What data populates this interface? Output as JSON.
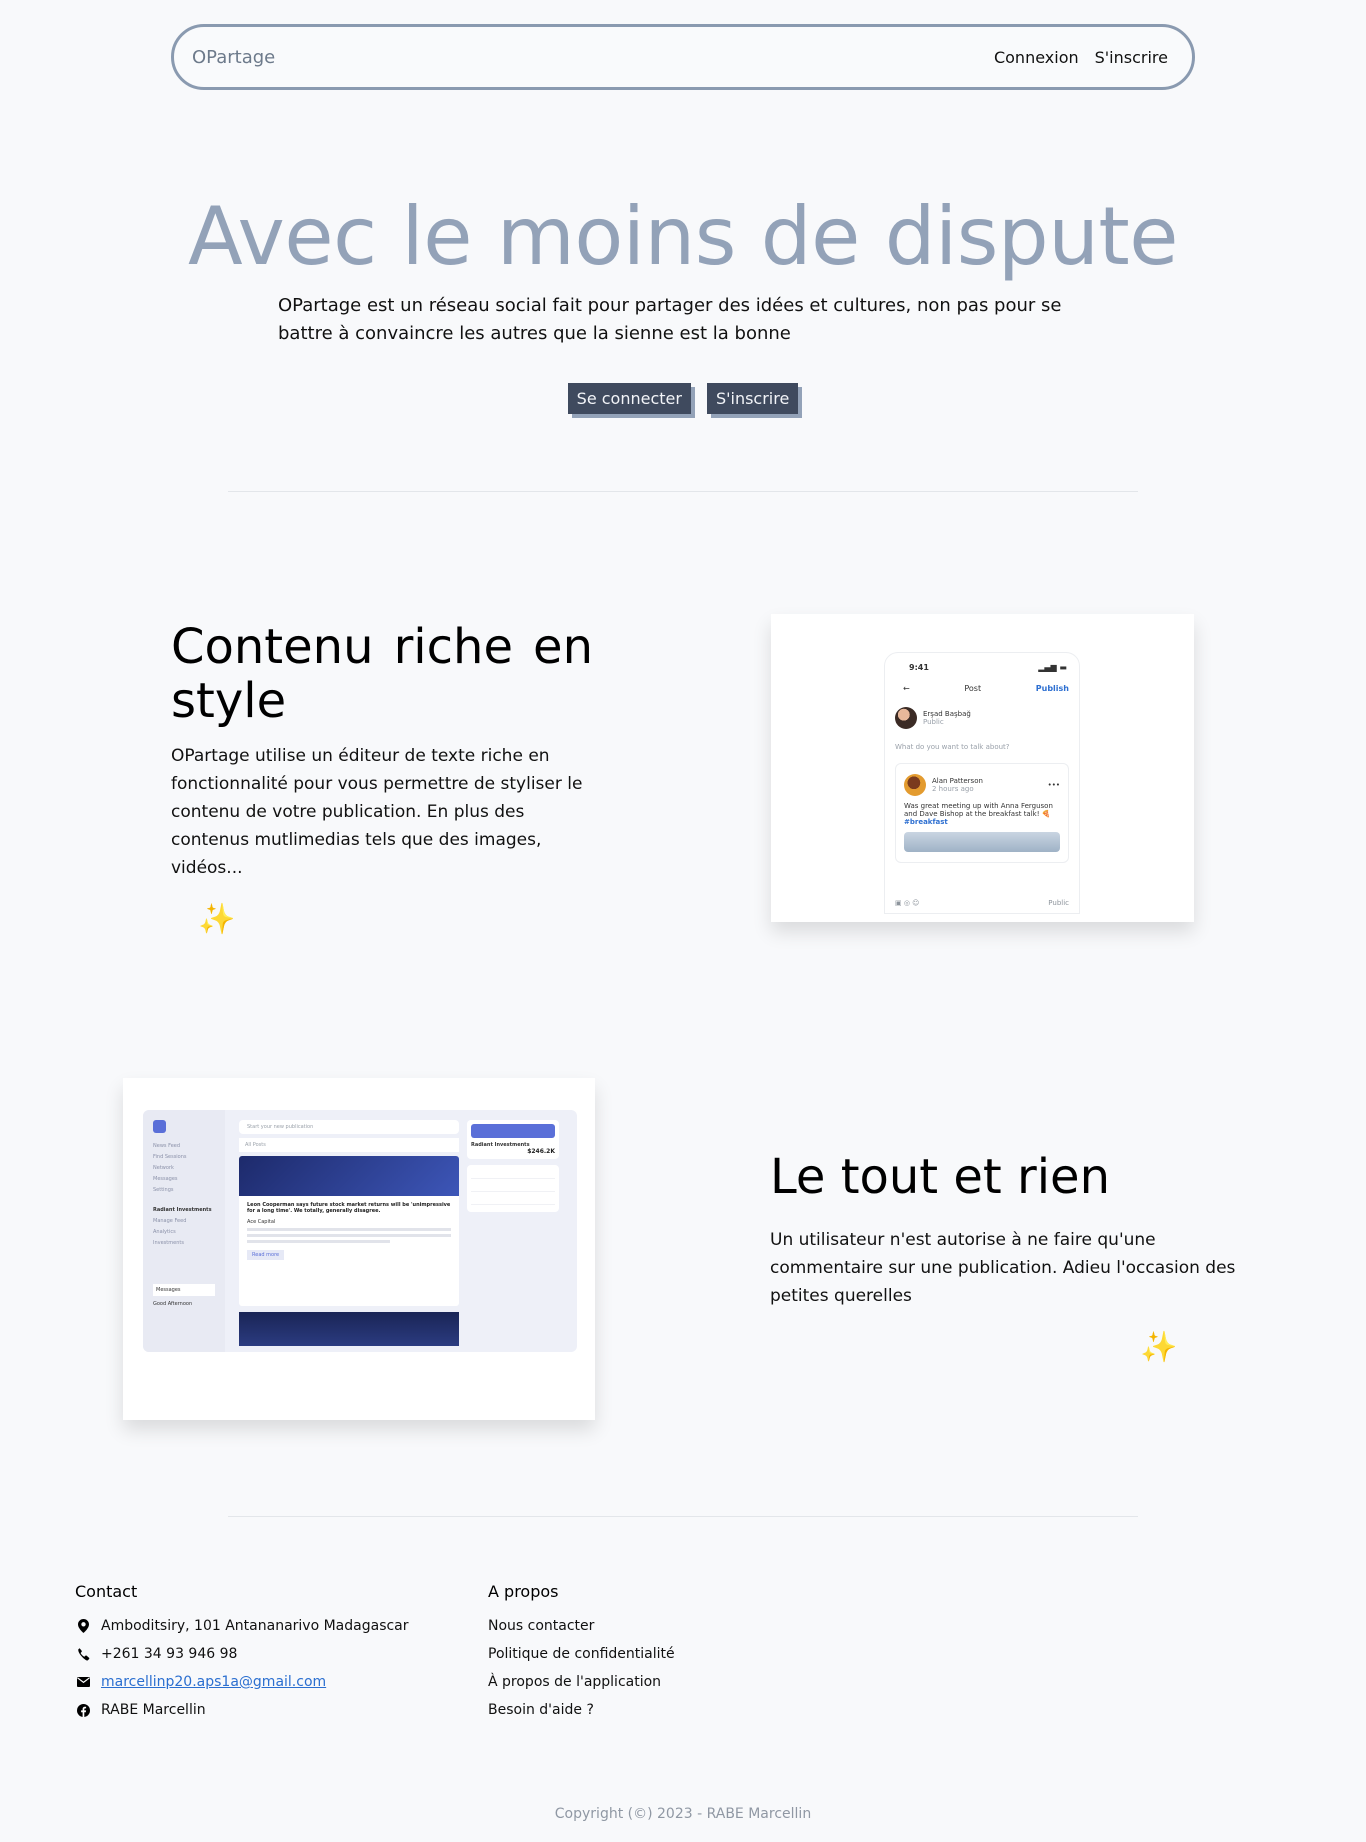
{
  "header": {
    "brand": "OPartage",
    "login_link": "Connexion",
    "signup_link": "S'inscrire"
  },
  "hero": {
    "title": "Avec le moins de dispute",
    "text": "OPartage est un réseau social fait pour partager des idées et cultures, non pas pour se battre à convaincre les autres que la sienne est la bonne",
    "primary_button": "Se connecter",
    "secondary_button": "S'inscrire"
  },
  "feature_rich": {
    "title": "Contenu riche en style",
    "text": "OPartage utilise un éditeur de texte riche en fonctionnalité pour vous permettre de styliser le contenu de votre publication. En plus des contenus mutlimedias tels que des images, vidéos...",
    "sparkle": "✨",
    "mockup": {
      "time": "9:41",
      "nav_title": "Post",
      "publish": "Publish",
      "user_name": "Erşad Başbağ",
      "visibility": "Public",
      "prompt": "What do you want to talk about?",
      "post_author": "Alan Patterson",
      "post_time": "2 hours ago",
      "post_text": "Was great meeting up with Anna Ferguson and Dave Bishop at the breakfast talk! 🍕",
      "post_tag": "#breakfast",
      "bottom_visibility": "Public"
    }
  },
  "feature_all": {
    "title": "Le tout et rien",
    "text": "Un utilisateur n'est autorise à ne faire qu'une commentaire sur une publication. Adieu l'occasion des petites querelles",
    "sparkle": "✨",
    "mockup": {
      "search_placeholder": "Start your new publication",
      "tab_1": "All Posts",
      "nav_items": [
        "News Feed",
        "Find Sessions",
        "Network",
        "Messages",
        "Settings"
      ],
      "section": "Radiant Investments",
      "side_items": [
        "Manage Feed",
        "Analytics",
        "Investments"
      ],
      "post_title": "Leon Cooperman says future stock market returns will be 'unimpressive for a long time'. We totally, generally disagree.",
      "author": "Ace Capital",
      "read_more": "Read more",
      "card_title": "Radiant Investments",
      "card_value": "$246.2K",
      "messages": "Messages",
      "greeting": "Good Afternoon"
    }
  },
  "footer": {
    "contact_title": "Contact",
    "address": "Amboditsiry, 101 Antananarivo Madagascar",
    "phone": "+261 34 93 946 98",
    "email": "marcellinp20.aps1a@gmail.com",
    "facebook": "RABE Marcellin",
    "about_title": "A propos",
    "about_links": [
      "Nous contacter",
      "Politique de confidentialité",
      "À propos de l'application",
      "Besoin d'aide ?"
    ],
    "copyright": "Copyright (©) 2023 - RABE Marcellin"
  }
}
